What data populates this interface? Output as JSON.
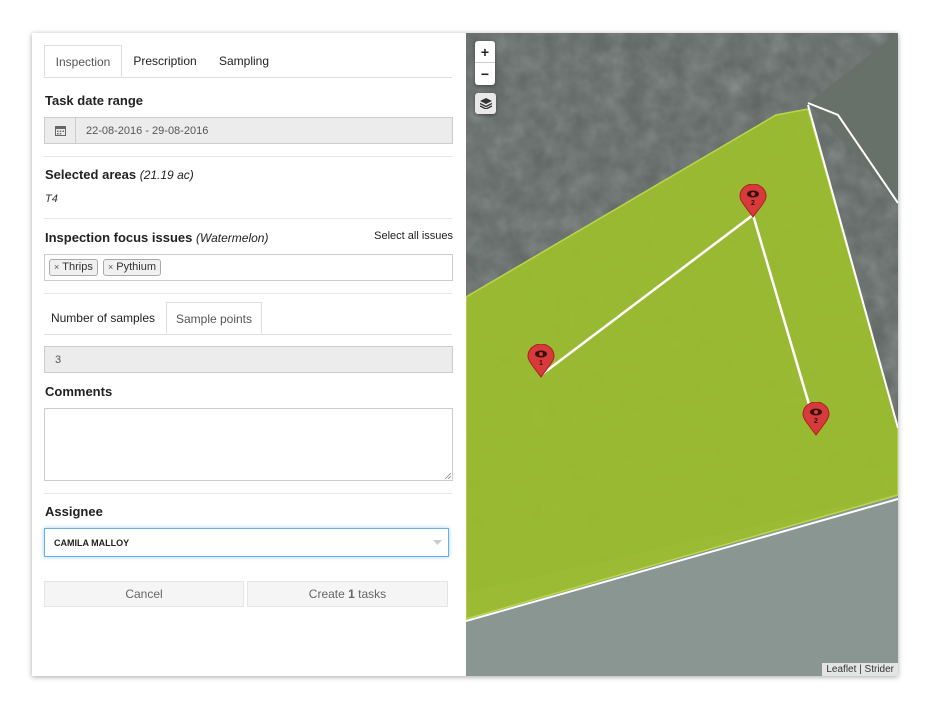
{
  "tabs": [
    "Inspection",
    "Prescription",
    "Sampling"
  ],
  "date_range": {
    "label": "Task date range",
    "value": "22-08-2016 - 29-08-2016",
    "icon": "calendar-icon"
  },
  "areas": {
    "label": "Selected areas",
    "size": "(21.19 ac)",
    "value": "T4"
  },
  "focus": {
    "label": "Inspection focus issues",
    "crop": "(Watermelon)",
    "select_all": "Select all issues",
    "tags": [
      "Thrips",
      "Pythium"
    ],
    "remove_symbol": "×"
  },
  "sample_tabs": [
    "Number of samples",
    "Sample points"
  ],
  "samples_value": "3",
  "comments": {
    "label": "Comments",
    "value": ""
  },
  "assignee": {
    "label": "Assignee",
    "value": "CAMILA MALLOY"
  },
  "buttons": {
    "cancel": "Cancel",
    "create_prefix": "Create ",
    "create_count": "1",
    "create_suffix": " tasks"
  },
  "map": {
    "zoom_in": "+",
    "zoom_out": "−",
    "attribution_leaflet": "Leaflet",
    "attribution_sep": " | ",
    "attribution_strider": "Strider",
    "markers": [
      {
        "label": "2"
      },
      {
        "label": "1"
      },
      {
        "label": "2"
      }
    ],
    "colors": {
      "field_fill": "#9bbd2e",
      "marker": "#d63a3a",
      "path": "#ffffff"
    }
  }
}
